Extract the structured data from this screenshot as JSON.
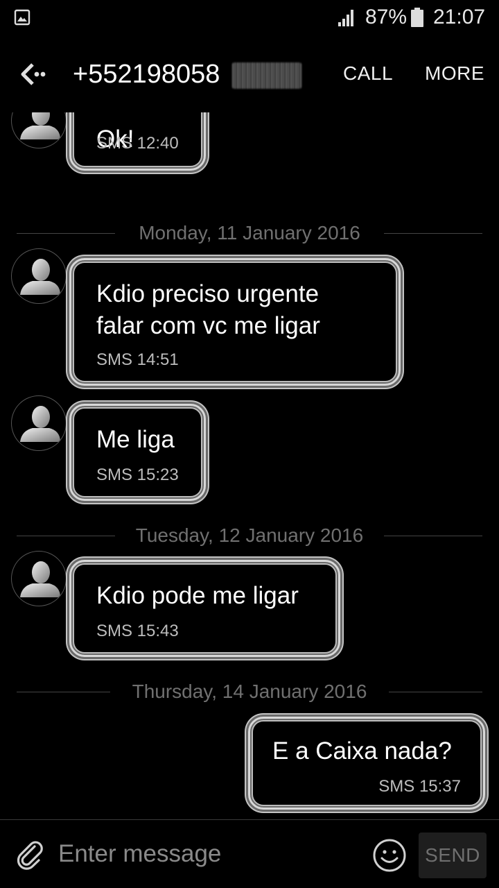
{
  "status_bar": {
    "battery_percent": "87%",
    "time": "21:07",
    "icons": [
      "gallery-icon",
      "signal-icon",
      "battery-icon"
    ]
  },
  "app_bar": {
    "title": "+552198058",
    "call_label": "CALL",
    "more_label": "MORE",
    "icons": [
      "back-icon"
    ]
  },
  "conversation": {
    "items": [
      {
        "type": "incoming",
        "text": "Ok!",
        "meta": "SMS 12:40"
      },
      {
        "type": "date",
        "text": "Monday, 11 January 2016"
      },
      {
        "type": "incoming",
        "lines": [
          "Kdio preciso urgente",
          "falar com vc me ligar"
        ],
        "meta": "SMS 14:51"
      },
      {
        "type": "incoming",
        "text": "Me liga",
        "meta": "SMS 15:23"
      },
      {
        "type": "date",
        "text": "Tuesday, 12 January 2016"
      },
      {
        "type": "incoming",
        "text": "Kdio pode me ligar",
        "meta": "SMS 15:43"
      },
      {
        "type": "date",
        "text": "Thursday, 14 January 2016"
      },
      {
        "type": "outgoing",
        "text": "E a Caixa nada?",
        "meta": "SMS 15:37"
      }
    ]
  },
  "input_bar": {
    "placeholder": "Enter message",
    "send_label": "SEND",
    "icons": [
      "paperclip-icon",
      "emoji-icon"
    ]
  },
  "colors": {
    "background": "#000000",
    "bubble_border": "#d8d8d8",
    "meta_text": "#bdbdbd",
    "date_text": "#707070"
  }
}
